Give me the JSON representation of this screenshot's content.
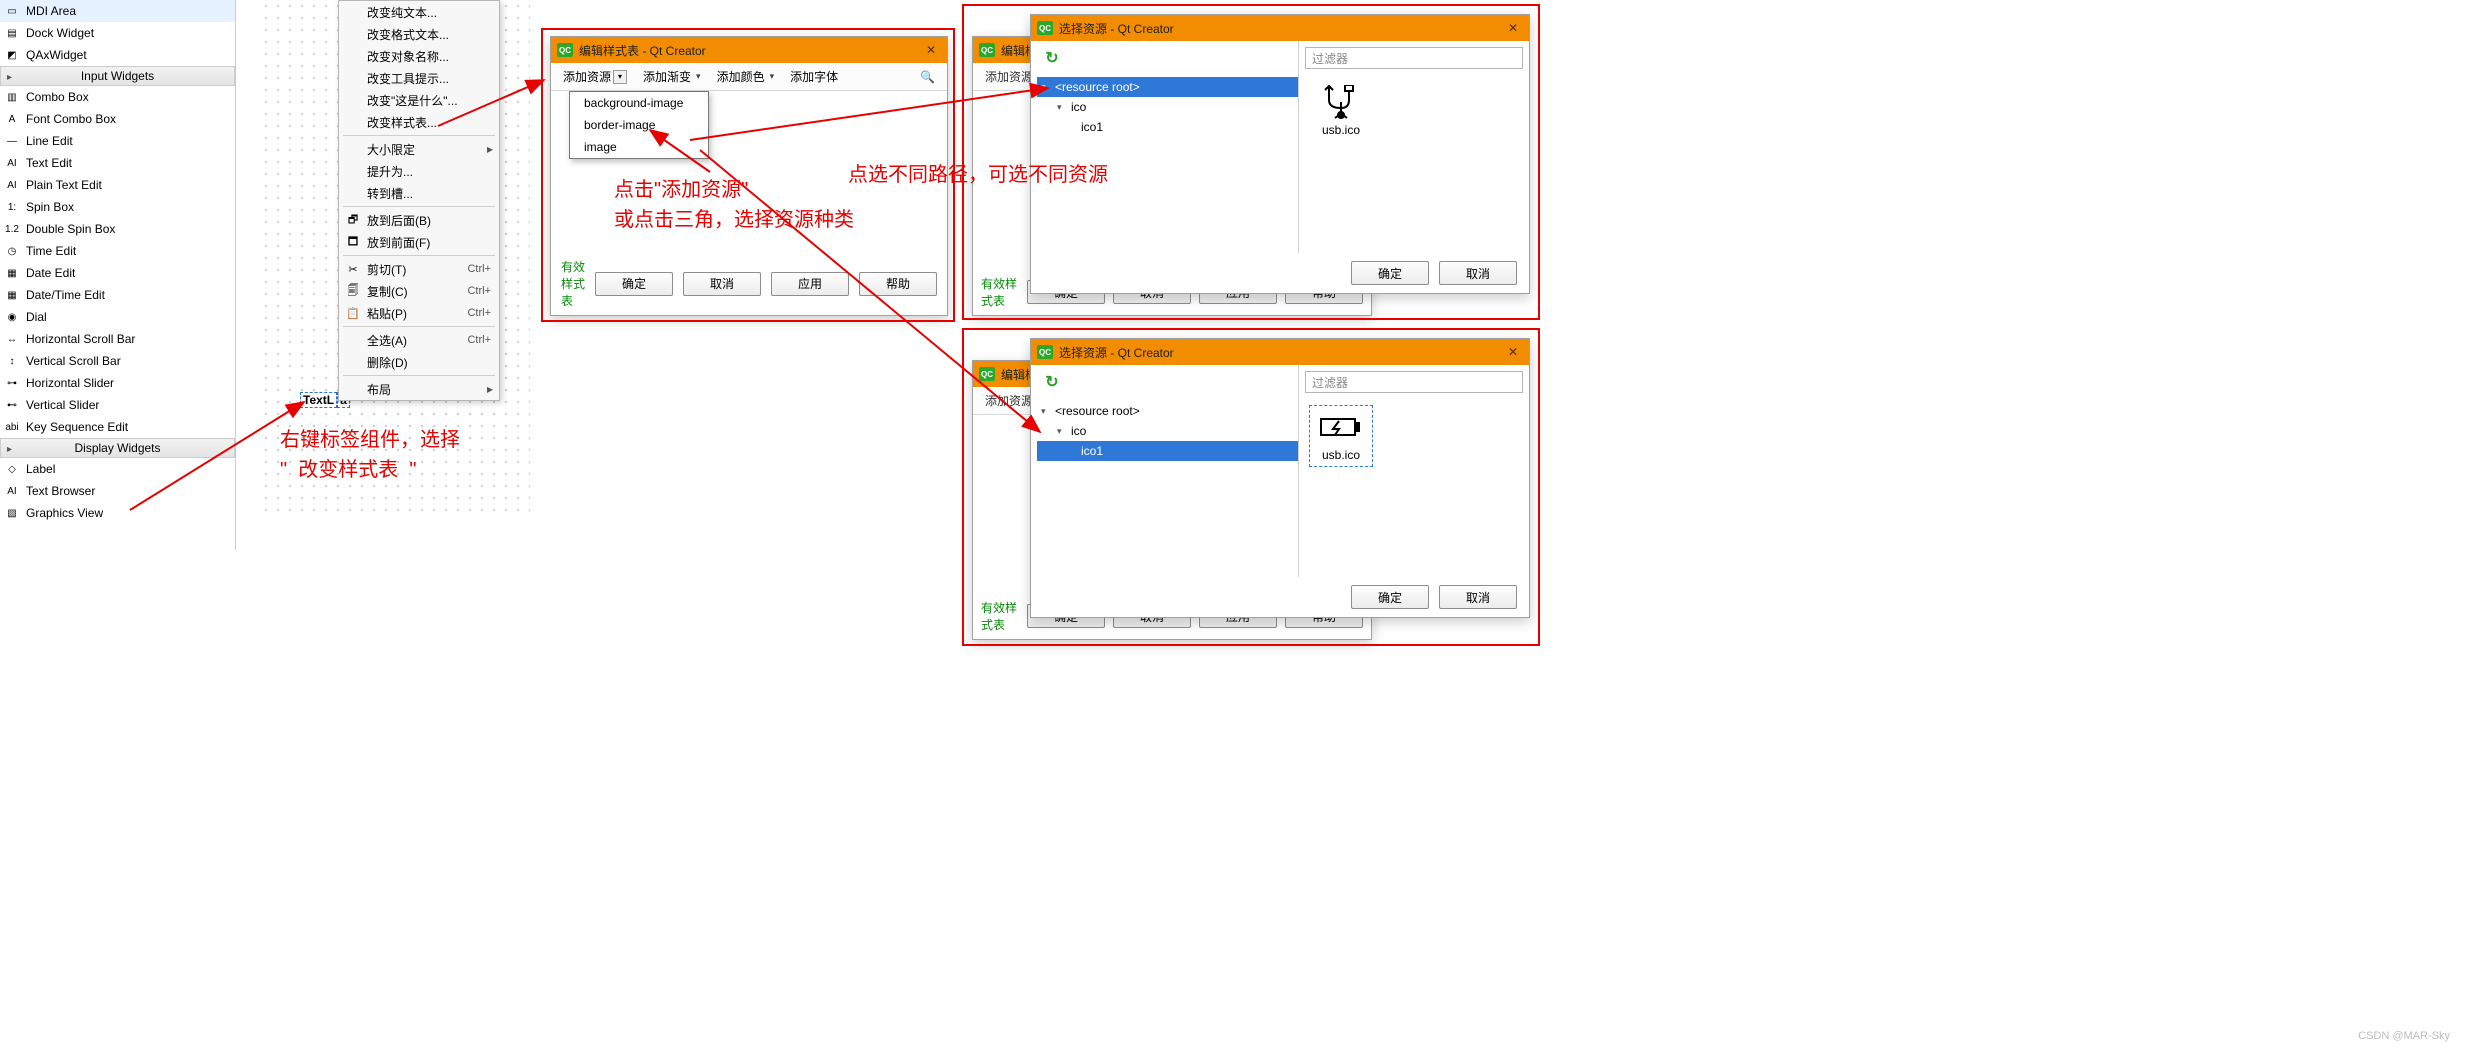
{
  "widget_box": {
    "items_a": [
      {
        "label": "MDI Area",
        "ico": "▭"
      },
      {
        "label": "Dock Widget",
        "ico": "▤"
      },
      {
        "label": "QAxWidget",
        "ico": "◩"
      }
    ],
    "cat1": "Input Widgets",
    "items_b": [
      {
        "label": "Combo Box",
        "ico": "▥"
      },
      {
        "label": "Font Combo Box",
        "ico": "A"
      },
      {
        "label": "Line Edit",
        "ico": "—"
      },
      {
        "label": "Text Edit",
        "ico": "AI"
      },
      {
        "label": "Plain Text Edit",
        "ico": "AI"
      },
      {
        "label": "Spin Box",
        "ico": "1:"
      },
      {
        "label": "Double Spin Box",
        "ico": "1.2"
      },
      {
        "label": "Time Edit",
        "ico": "◷"
      },
      {
        "label": "Date Edit",
        "ico": "▦"
      },
      {
        "label": "Date/Time Edit",
        "ico": "▦"
      },
      {
        "label": "Dial",
        "ico": "◉"
      },
      {
        "label": "Horizontal Scroll Bar",
        "ico": "↔"
      },
      {
        "label": "Vertical Scroll Bar",
        "ico": "↕"
      },
      {
        "label": "Horizontal Slider",
        "ico": "⊶"
      },
      {
        "label": "Vertical Slider",
        "ico": "⊷"
      },
      {
        "label": "Key Sequence Edit",
        "ico": "abi"
      }
    ],
    "cat2": "Display Widgets",
    "items_c": [
      {
        "label": "Label",
        "ico": "◇"
      },
      {
        "label": "Text Browser",
        "ico": "AI"
      },
      {
        "label": "Graphics View",
        "ico": "▧"
      }
    ]
  },
  "canvas": {
    "label_text": "TextL"
  },
  "context_menu": {
    "items": [
      {
        "label": "改变纯文本...",
        "sub": false
      },
      {
        "label": "改变格式文本...",
        "sub": false
      },
      {
        "label": "改变对象名称...",
        "sub": false
      },
      {
        "label": "改变工具提示...",
        "sub": false
      },
      {
        "label": "改变\"这是什么\"...",
        "sub": false
      },
      {
        "label": "改变样式表...",
        "sub": false
      },
      {
        "sep": true
      },
      {
        "label": "大小限定",
        "sub": true
      },
      {
        "label": "提升为...",
        "sub": false
      },
      {
        "label": "转到槽...",
        "sub": false
      },
      {
        "sep": true
      },
      {
        "label": "放到后面(B)",
        "ico": "🗗"
      },
      {
        "label": "放到前面(F)",
        "ico": "🗖"
      },
      {
        "sep": true
      },
      {
        "label": "剪切(T)",
        "ico": "✂",
        "sc": "Ctrl+"
      },
      {
        "label": "复制(C)",
        "ico": "🗐",
        "sc": "Ctrl+"
      },
      {
        "label": "粘贴(P)",
        "ico": "📋",
        "sc": "Ctrl+"
      },
      {
        "sep": true
      },
      {
        "label": "全选(A)",
        "sc": "Ctrl+"
      },
      {
        "label": "删除(D)"
      },
      {
        "sep": true
      },
      {
        "label": "布局",
        "sub": true
      }
    ]
  },
  "style_dialog": {
    "title": "编辑样式表 - Qt Creator",
    "toolbar": {
      "add_res": "添加资源",
      "add_grad": "添加渐变",
      "add_color": "添加颜色",
      "add_font": "添加字体"
    },
    "dropdown": [
      "background-image",
      "border-image",
      "image"
    ],
    "valid": "有效样式表",
    "ok": "确定",
    "cancel": "取消",
    "apply": "应用",
    "help": "帮助"
  },
  "under_dialog": {
    "title": "编辑样",
    "add_res": "添加资源",
    "valid": "有效样式表"
  },
  "under_buttons": [
    "确定",
    "取消",
    "应用",
    "帮助"
  ],
  "res_dialog1": {
    "title": "选择资源 - Qt Creator",
    "filter": "过滤器",
    "tree": {
      "root": "<resource root>",
      "folder": "ico",
      "leaf": "ico1"
    },
    "preview": "usb.ico",
    "ok": "确定",
    "cancel": "取消"
  },
  "res_dialog2": {
    "title": "选择资源 - Qt Creator",
    "filter": "过滤器",
    "tree": {
      "root": "<resource root>",
      "folder": "ico",
      "leaf": "ico1"
    },
    "preview": "usb.ico",
    "ok": "确定",
    "cancel": "取消"
  },
  "annotations": {
    "a1": "右键标签组件，选择\n\"  改变样式表  \"",
    "a2": "点击\"添加资源\"\n或点击三角，选择资源种类",
    "a3": "点选不同路径，可选不同资源"
  },
  "watermark": "CSDN @MAR-Sky"
}
